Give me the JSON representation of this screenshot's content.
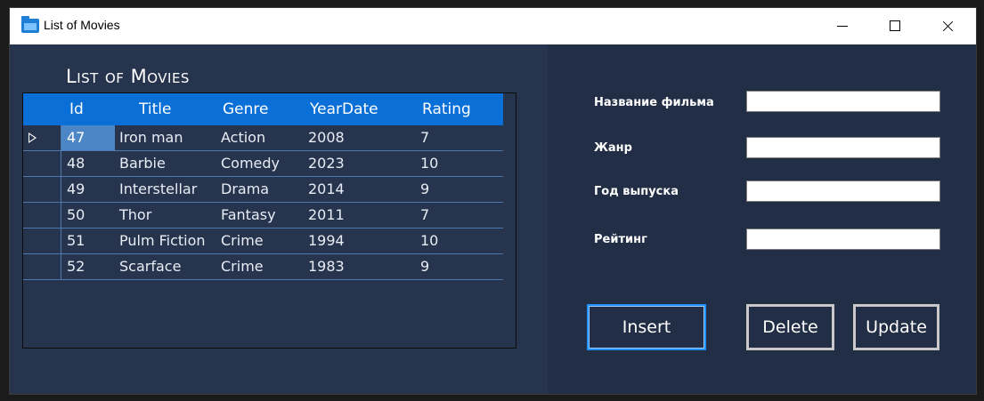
{
  "window": {
    "title": "List of Movies",
    "icon": "folder-app-icon"
  },
  "left": {
    "section_title": "List of Movies",
    "grid": {
      "columns": [
        "Id",
        "Title",
        "Genre",
        "YearDate",
        "Rating"
      ],
      "selected_row_index": 0,
      "rows": [
        {
          "id": "47",
          "title": "Iron man",
          "genre": "Action",
          "year": "2008",
          "rating": "7"
        },
        {
          "id": "48",
          "title": "Barbie",
          "genre": "Comedy",
          "year": "2023",
          "rating": "10"
        },
        {
          "id": "49",
          "title": "Interstellar",
          "genre": "Drama",
          "year": "2014",
          "rating": "9"
        },
        {
          "id": "50",
          "title": "Thor",
          "genre": "Fantasy",
          "year": "2011",
          "rating": "7"
        },
        {
          "id": "51",
          "title": "Pulm Fiction",
          "genre": "Crime",
          "year": "1994",
          "rating": "10"
        },
        {
          "id": "52",
          "title": "Scarface",
          "genre": "Crime",
          "year": "1983",
          "rating": "9"
        }
      ]
    }
  },
  "form": {
    "name_label": "Название фильма",
    "name_value": "",
    "genre_label": "Жанр",
    "genre_value": "",
    "year_label": "Год выпуска",
    "year_value": "",
    "rating_label": "Рейтинг",
    "rating_value": ""
  },
  "buttons": {
    "insert": "Insert",
    "delete": "Delete",
    "update": "Update"
  },
  "colors": {
    "panel_left": "#26344d",
    "panel_right": "#222e45",
    "grid_header": "#0a6fd6",
    "selected_cell": "#4d86c6",
    "insert_border": "#1e90ff"
  }
}
